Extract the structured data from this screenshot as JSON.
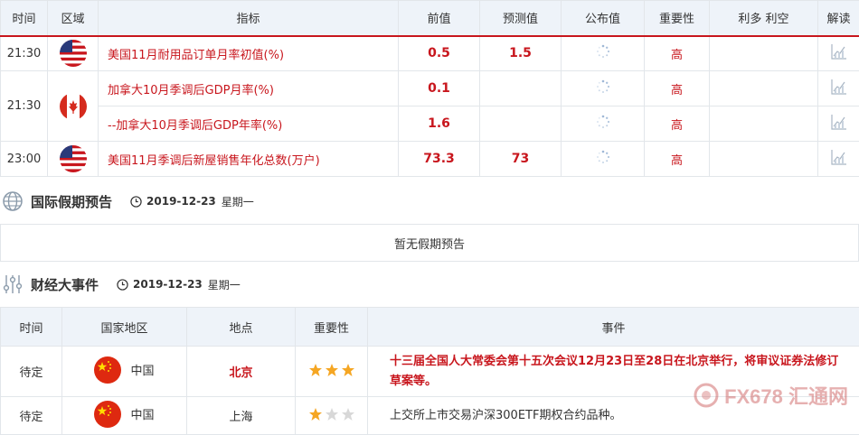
{
  "economic_table": {
    "headers": [
      "时间",
      "区域",
      "指标",
      "前值",
      "预测值",
      "公布值",
      "重要性",
      "利多 利空",
      "解读"
    ],
    "rows": [
      {
        "time": "21:30",
        "region": "us-flag-icon",
        "indicator": "美国11月耐用品订单月率初值(%)",
        "previous": "0.5",
        "forecast": "1.5",
        "actual": "",
        "importance": "高",
        "impact": ""
      },
      {
        "time": "21:30",
        "region": "ca-flag-icon",
        "indicator": "加拿大10月季调后GDP月率(%)",
        "previous": "0.1",
        "forecast": "",
        "actual": "",
        "importance": "高",
        "impact": ""
      },
      {
        "time": "",
        "region": "",
        "indicator": "--加拿大10月季调后GDP年率(%)",
        "previous": "1.6",
        "forecast": "",
        "actual": "",
        "importance": "高",
        "impact": ""
      },
      {
        "time": "23:00",
        "region": "us-flag-icon",
        "indicator": "美国11月季调后新屋销售年化总数(万户)",
        "previous": "73.3",
        "forecast": "73",
        "actual": "",
        "importance": "高",
        "impact": ""
      }
    ]
  },
  "holiday_section": {
    "title": "国际假期预告",
    "date": "2019-12-23",
    "weekday": "星期一",
    "empty_text": "暂无假期预告"
  },
  "events_section": {
    "title": "财经大事件",
    "date": "2019-12-23",
    "weekday": "星期一",
    "headers": [
      "时间",
      "国家地区",
      "地点",
      "重要性",
      "事件"
    ],
    "rows": [
      {
        "time": "待定",
        "country": "中国",
        "city": "北京",
        "stars": 3,
        "event": "十三届全国人大常委会第十五次会议12月23日至28日在北京举行，将审议证券法修订草案等。"
      },
      {
        "time": "待定",
        "country": "中国",
        "city": "上海",
        "stars": 1,
        "event": "上交所上市交易沪深300ETF期权合约品种。"
      }
    ]
  },
  "watermark": "FX678 汇通网",
  "colors": {
    "accent_red": "#c8161d",
    "header_bg": "#eef3f9",
    "border": "#e2e6ea",
    "star": "#f5a623"
  }
}
